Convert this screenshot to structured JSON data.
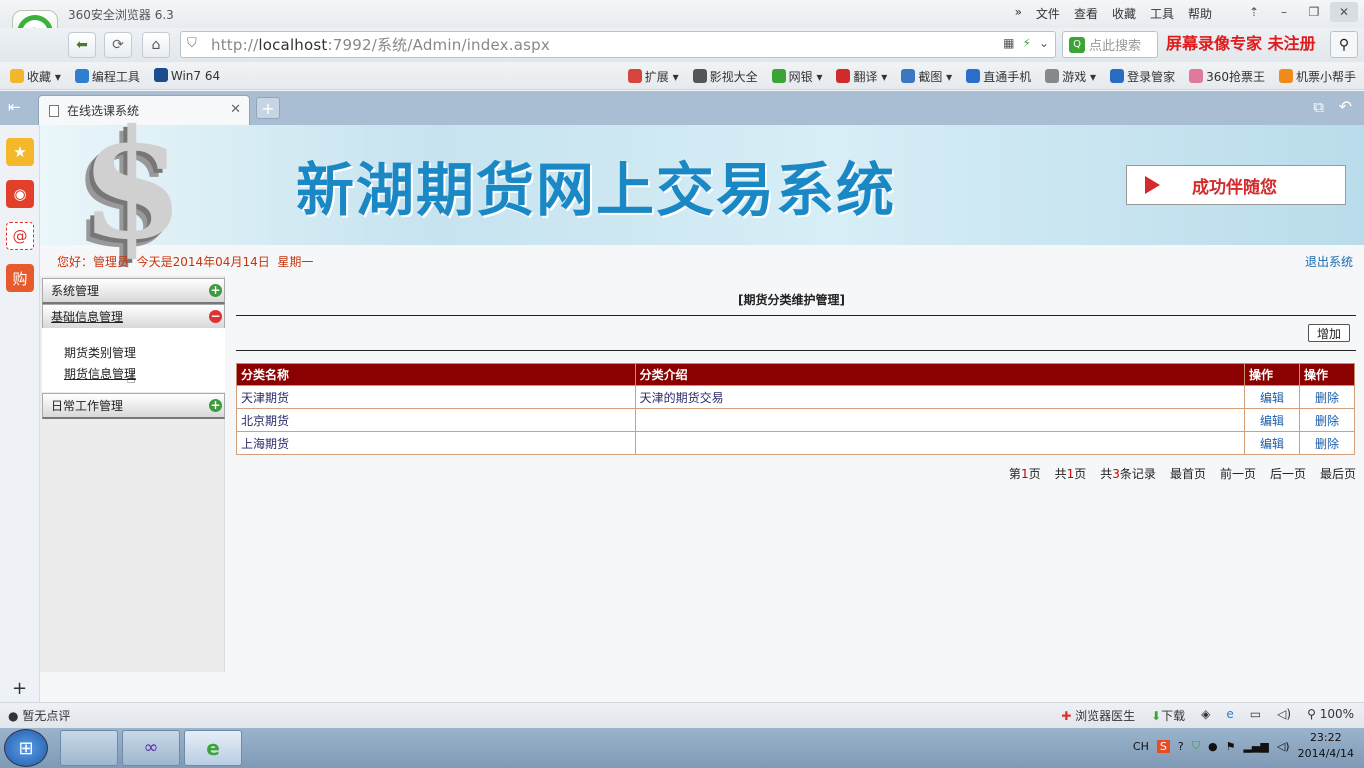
{
  "browser": {
    "app_title": "360安全浏览器 6.3",
    "menus": [
      "文件",
      "查看",
      "收藏",
      "工具",
      "帮助"
    ],
    "url_prefix": "http://",
    "url_host": "localhost",
    "url_rest": ":7992/系统/Admin/index.aspx",
    "search_placeholder": "点此搜索",
    "watermark": "屏幕录像专家 未注册",
    "favorites": [
      "收藏",
      "编程工具",
      "Win7 64"
    ],
    "toolbar": [
      "扩展",
      "影视大全",
      "网银",
      "翻译",
      "截图",
      "直通手机",
      "游戏",
      "登录管家",
      "360抢票王",
      "机票小帮手"
    ],
    "tab_title": "在线选课系统"
  },
  "site": {
    "banner_title": "新湖期货网上交易系统",
    "banner_slogan": "成功伴随您",
    "greeting": "您好：管理员  今天是2014年04月14日  星期一",
    "logout": "退出系统"
  },
  "nav": {
    "groups": [
      "系统管理",
      "基础信息管理",
      "日常工作管理"
    ],
    "subitems": [
      "期货类别管理",
      "期货信息管理"
    ]
  },
  "main": {
    "title": "[期货分类维护管理]",
    "add_label": "增加",
    "columns": [
      "分类名称",
      "分类介绍",
      "操作",
      "操作"
    ],
    "rows": [
      {
        "name": "天津期货",
        "desc": "天津的期货交易",
        "edit": "编辑",
        "del": "删除"
      },
      {
        "name": "北京期货",
        "desc": "",
        "edit": "编辑",
        "del": "删除"
      },
      {
        "name": "上海期货",
        "desc": "",
        "edit": "编辑",
        "del": "删除"
      }
    ],
    "pager": {
      "p1a": "第",
      "page": "1",
      "p1b": "页",
      "p2a": "共",
      "pages": "1",
      "p2b": "页",
      "p3a": "共",
      "records": "3",
      "p3b": "条记录",
      "first": "最首页",
      "prev": "前一页",
      "next": "后一页",
      "last": "最后页"
    }
  },
  "status": {
    "left": "暂无点评",
    "doctor": "浏览器医生",
    "download": "下载",
    "zoom": "100%"
  },
  "taskbar": {
    "lang": "CH",
    "time": "23:22",
    "date": "2014/4/14"
  },
  "colors": {
    "table_header": "#8b0000",
    "banner_title": "#1a88c4",
    "greeting": "#c8350d"
  }
}
